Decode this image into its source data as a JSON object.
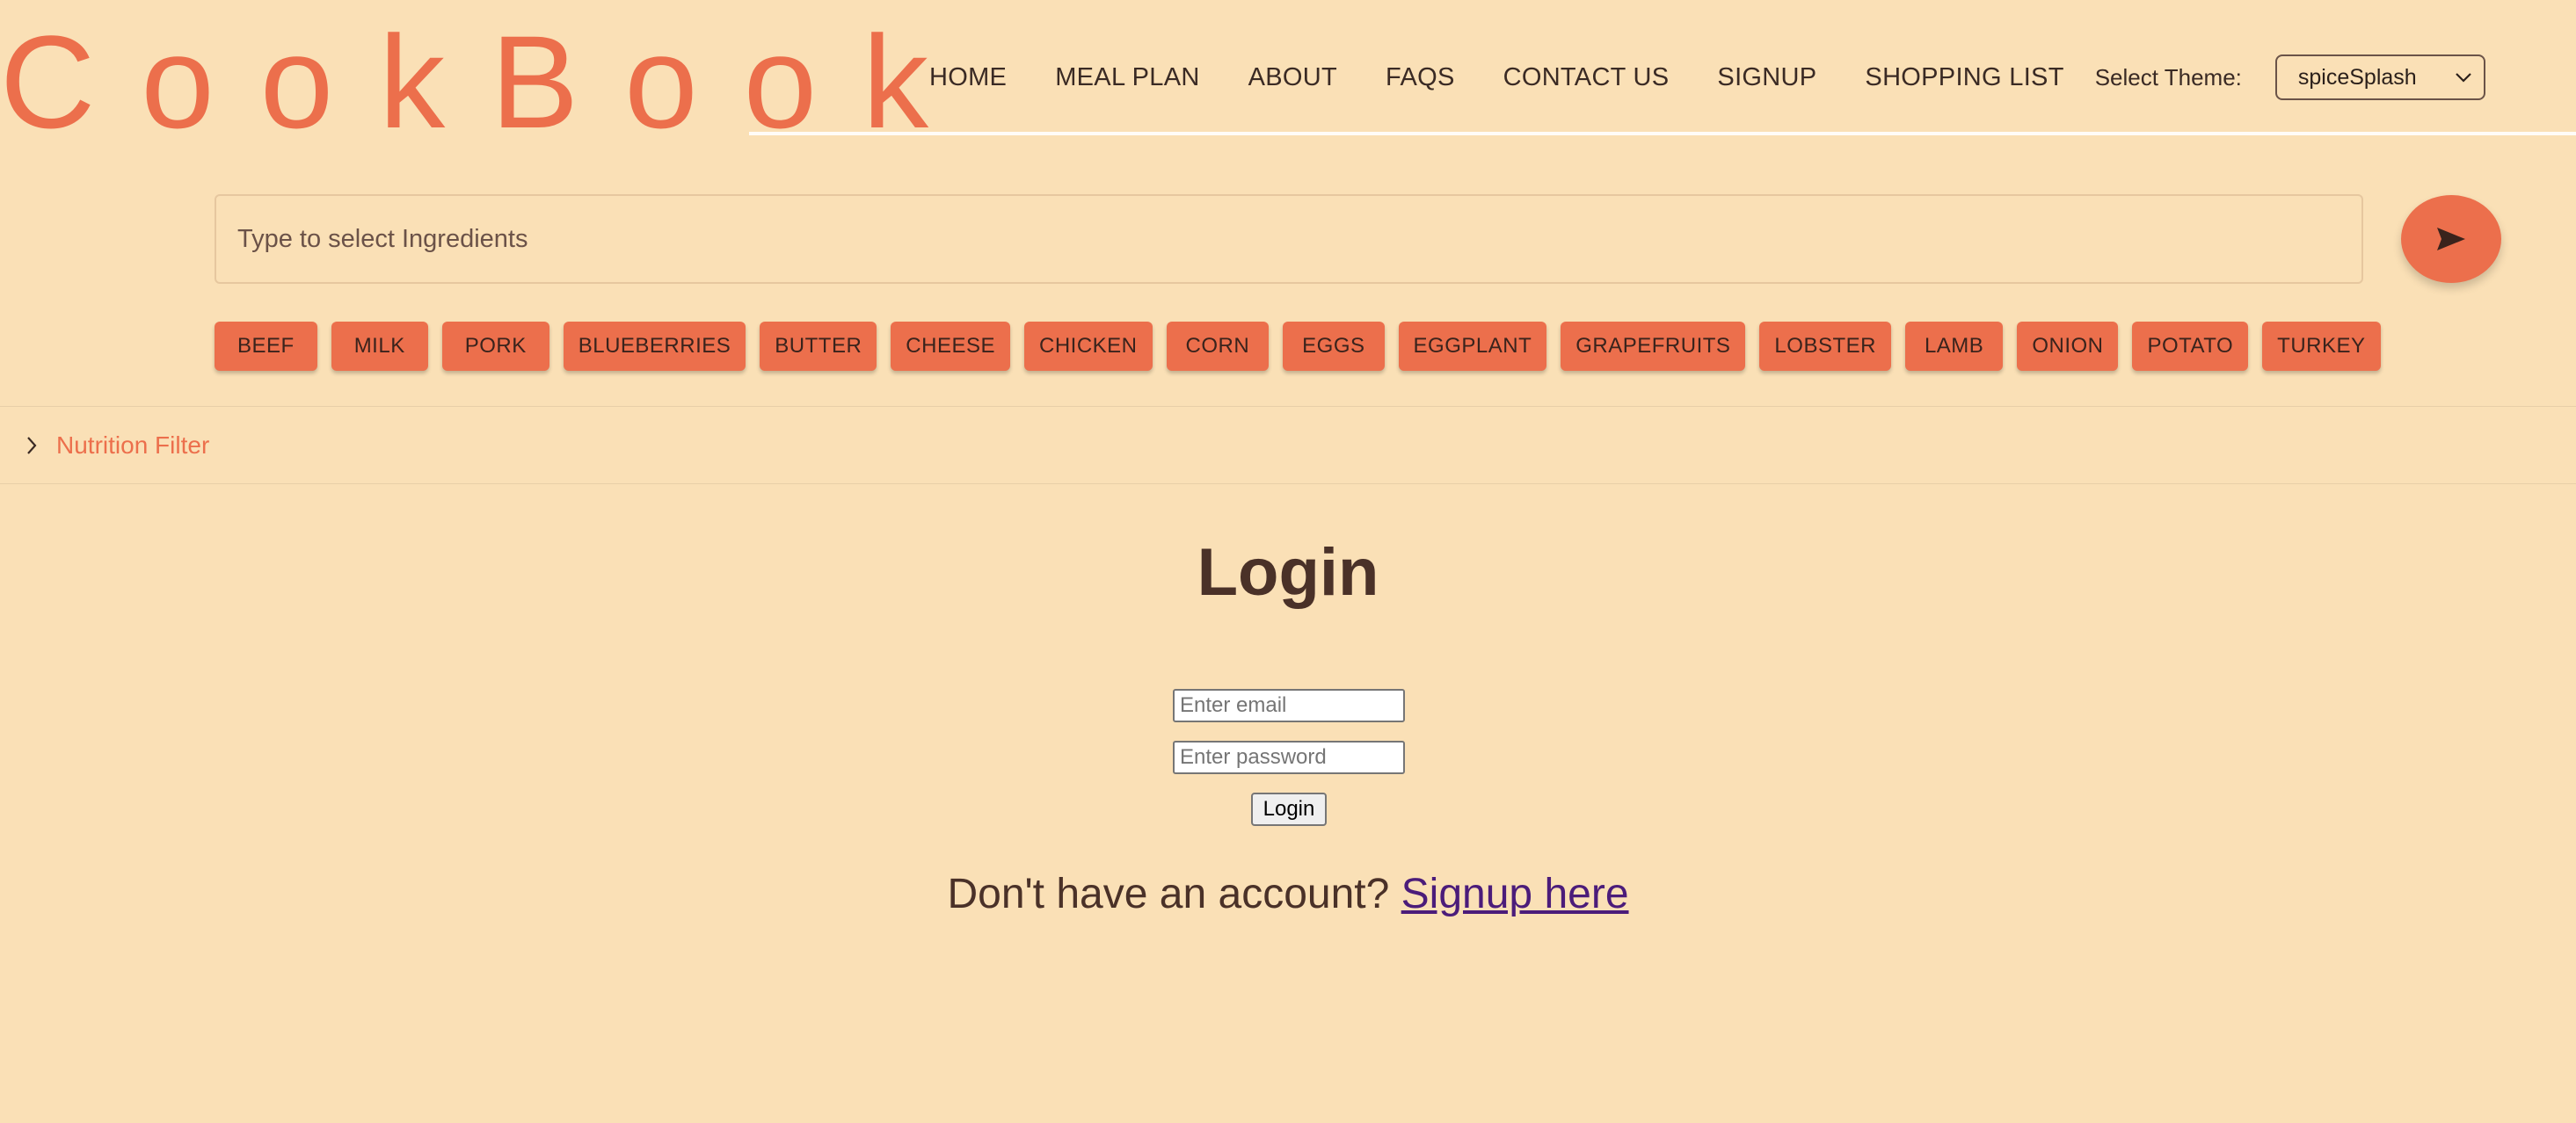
{
  "header": {
    "logo_text": "CookBook",
    "nav": [
      "HOME",
      "MEAL PLAN",
      "ABOUT",
      "FAQS",
      "CONTACT US",
      "SIGNUP",
      "SHOPPING LIST"
    ],
    "theme_label": "Select Theme:",
    "theme_value": "spiceSplash"
  },
  "search": {
    "placeholder": "Type to select Ingredients",
    "send_icon": "send-icon"
  },
  "ingredients": [
    "BEEF",
    "MILK",
    "PORK",
    "BLUEBERRIES",
    "BUTTER",
    "CHEESE",
    "CHICKEN",
    "CORN",
    "EGGS",
    "EGGPLANT",
    "GRAPEFRUITS",
    "LOBSTER",
    "LAMB",
    "ONION",
    "POTATO",
    "TURKEY"
  ],
  "filter": {
    "label": "Nutrition Filter",
    "icon": "chevron-right-icon"
  },
  "login": {
    "title": "Login",
    "email_placeholder": "Enter email",
    "password_placeholder": "Enter password",
    "button_label": "Login",
    "signup_prompt": "Don't have an account?",
    "signup_link": "Signup here"
  },
  "colors": {
    "background": "#fae0b6",
    "accent": "#ec6f4c",
    "text": "#4a3128",
    "link": "#4b1c7a"
  }
}
